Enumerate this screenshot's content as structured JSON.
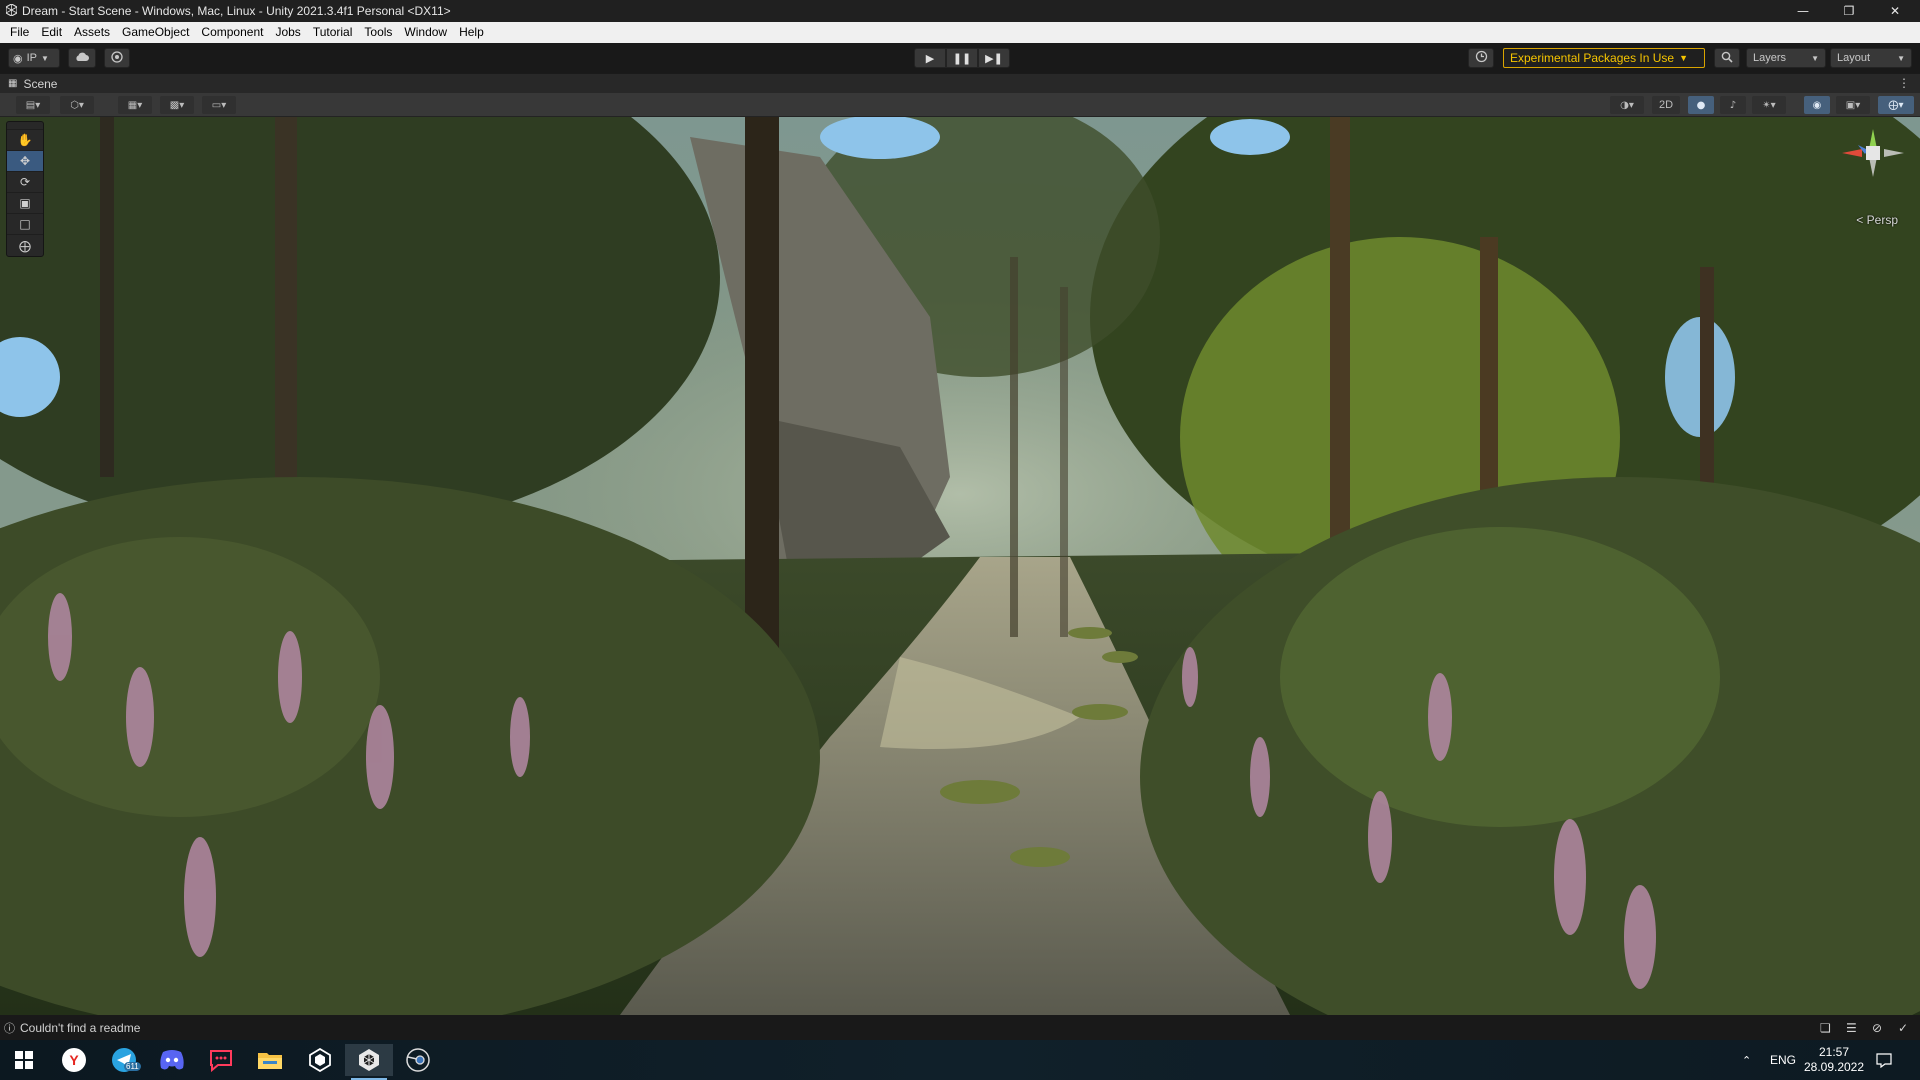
{
  "window": {
    "title": "Dream - Start Scene - Windows, Mac, Linux - Unity 2021.3.4f1 Personal <DX11>",
    "controls": [
      "minimize-icon",
      "restore-icon",
      "close-icon"
    ]
  },
  "menubar": {
    "items": [
      "File",
      "Edit",
      "Assets",
      "GameObject",
      "Component",
      "Jobs",
      "Tutorial",
      "Tools",
      "Window",
      "Help"
    ]
  },
  "toolbar": {
    "account_label": "IP",
    "experimental_label": "Experimental Packages In Use",
    "layers_label": "Layers",
    "layout_label": "Layout"
  },
  "scene": {
    "tab_label": "Scene",
    "mode_2d": "2D",
    "persp_label": "< Persp"
  },
  "status": {
    "message": "Couldn't find a readme"
  },
  "taskbar": {
    "apps": [
      "start-icon",
      "yandex-browser-icon",
      "telegram-icon",
      "discord-icon",
      "chat-app-icon",
      "file-explorer-icon",
      "unity-hub-icon",
      "unity-editor-icon",
      "blender-icon"
    ],
    "telegram_badge": "611",
    "language": "ENG",
    "time": "21:57",
    "date": "28.09.2022"
  },
  "colors": {
    "accent_selected": "#3a5a80",
    "experimental_warning": "#f5c400",
    "editor_bg": "#191919",
    "menubar_bg": "#f0f0f0"
  }
}
